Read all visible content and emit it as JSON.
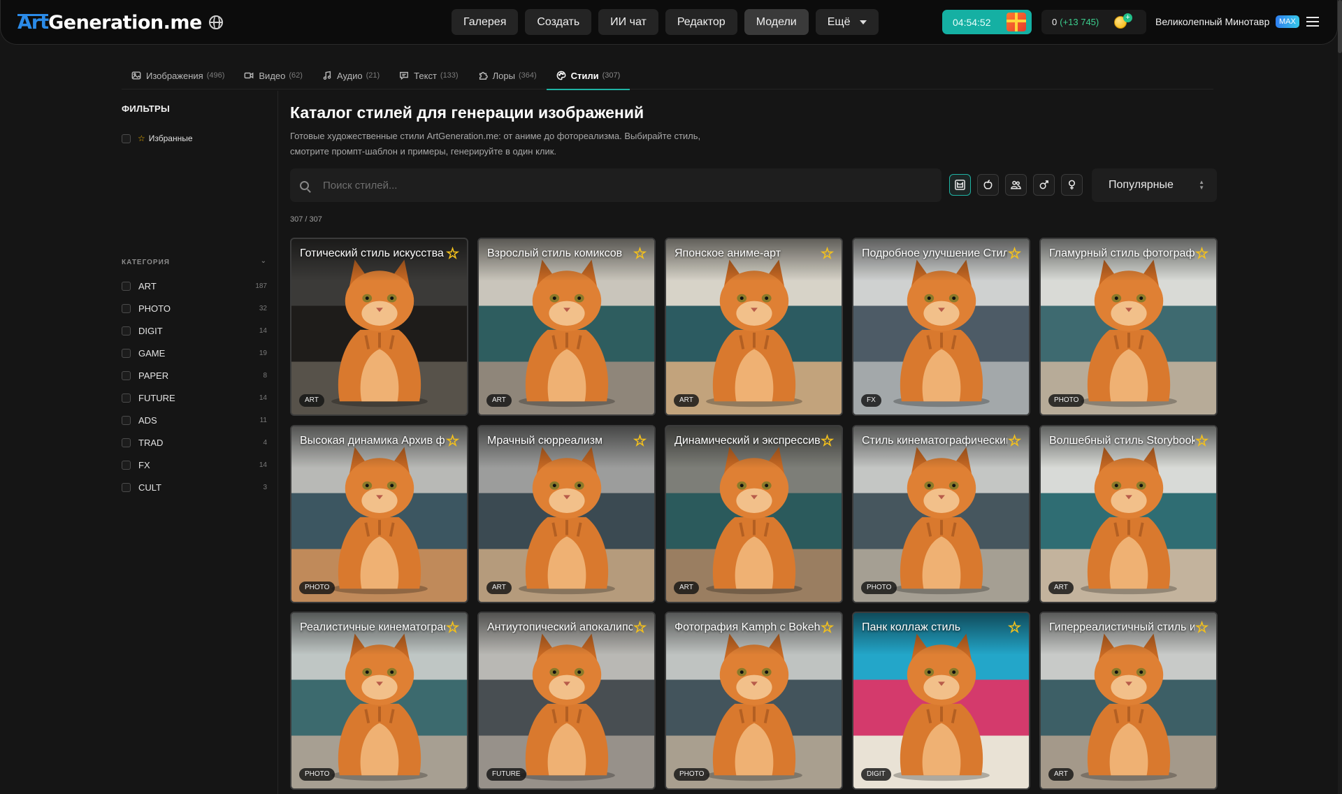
{
  "header": {
    "logo_art": "Art",
    "logo_rest": "Generation.me",
    "nav": [
      {
        "label": "Галерея"
      },
      {
        "label": "Создать"
      },
      {
        "label": "ИИ чат"
      },
      {
        "label": "Редактор"
      },
      {
        "label": "Модели",
        "active": true
      },
      {
        "label": "Ещё"
      }
    ],
    "timer": "04:54:52",
    "coins": "0",
    "coins_plus": "(+13 745)",
    "username": "Великолепный Минотавр",
    "badge": "MAX"
  },
  "subtabs": [
    {
      "label": "Изображения",
      "count": "(496)",
      "icon": "image-icon"
    },
    {
      "label": "Видео",
      "count": "(62)",
      "icon": "video-icon"
    },
    {
      "label": "Аудио",
      "count": "(21)",
      "icon": "music-icon"
    },
    {
      "label": "Текст",
      "count": "(133)",
      "icon": "chat-icon"
    },
    {
      "label": "Лоры",
      "count": "(364)",
      "icon": "puzzle-icon"
    },
    {
      "label": "Стили",
      "count": "(307)",
      "icon": "palette-icon",
      "active": true
    }
  ],
  "sidebar": {
    "title": "ФИЛЬТРЫ",
    "favorites": "Избранные",
    "categories_head": "КАТЕГОРИЯ",
    "categories": [
      {
        "name": "ART",
        "count": "187"
      },
      {
        "name": "PHOTO",
        "count": "32"
      },
      {
        "name": "DIGIT",
        "count": "14"
      },
      {
        "name": "GAME",
        "count": "19"
      },
      {
        "name": "PAPER",
        "count": "8"
      },
      {
        "name": "FUTURE",
        "count": "14"
      },
      {
        "name": "ADS",
        "count": "11"
      },
      {
        "name": "TRAD",
        "count": "4"
      },
      {
        "name": "FX",
        "count": "14"
      },
      {
        "name": "CULT",
        "count": "3"
      }
    ]
  },
  "main": {
    "title": "Каталог стилей для генерации изображений",
    "description": "Готовые художественные стили ArtGeneration.me: от аниме до фотореализма. Выбирайте стиль, смотрите промпт-шаблон и примеры, генерируйте в один клик.",
    "search_placeholder": "Поиск стилей...",
    "sort_label": "Популярные",
    "count": "307 / 307",
    "filter_toggles": [
      {
        "icon": "cat-face-icon",
        "on": true
      },
      {
        "icon": "apple-icon"
      },
      {
        "icon": "group-icon"
      },
      {
        "icon": "male-icon"
      },
      {
        "icon": "female-icon"
      }
    ]
  },
  "cards": [
    {
      "title": "Готический стиль искусства",
      "category": "ART",
      "colors": [
        "#3b3a38",
        "#1e1c1a",
        "#57524a"
      ]
    },
    {
      "title": "Взрослый стиль комиксов",
      "category": "ART",
      "colors": [
        "#c9c5bb",
        "#2e5d5f",
        "#8f867a"
      ]
    },
    {
      "title": "Японское аниме-арт",
      "category": "ART",
      "colors": [
        "#d7d3c8",
        "#2c5b61",
        "#c2a37c"
      ]
    },
    {
      "title": "Подробное улучшение Стиль",
      "category": "FX",
      "colors": [
        "#cfd1d0",
        "#4d5b66",
        "#a3a8aa"
      ]
    },
    {
      "title": "Гламурный стиль фотографии",
      "category": "PHOTO",
      "colors": [
        "#d9dad6",
        "#3e6a70",
        "#b7ab98"
      ]
    },
    {
      "title": "Высокая динамика Архив фото",
      "category": "PHOTO",
      "colors": [
        "#b8b9b6",
        "#3c5661",
        "#c08a5a"
      ]
    },
    {
      "title": "Мрачный сюрреализм",
      "category": "ART",
      "colors": [
        "#9c9d9c",
        "#3b4a52",
        "#b59b7c"
      ]
    },
    {
      "title": "Динамический и экспрессивный",
      "category": "ART",
      "colors": [
        "#7d7e78",
        "#2b5a5c",
        "#9a7e61"
      ]
    },
    {
      "title": "Стиль кинематографический",
      "category": "PHOTO",
      "colors": [
        "#c4c6c4",
        "#46565e",
        "#a59f93"
      ]
    },
    {
      "title": "Волшебный стиль Storybook",
      "category": "ART",
      "colors": [
        "#d8dad7",
        "#2f6d73",
        "#c3b39d"
      ]
    },
    {
      "title": "Реалистичные кинематографичные",
      "category": "PHOTO",
      "colors": [
        "#bfc6c4",
        "#3c6a6e",
        "#a79f92"
      ]
    },
    {
      "title": "Антиутопический апокалипсис",
      "category": "FUTURE",
      "colors": [
        "#b9b8b4",
        "#484e52",
        "#97918a"
      ]
    },
    {
      "title": "Фотография Kamph с Bokeh",
      "category": "PHOTO",
      "colors": [
        "#bfc3c1",
        "#43545c",
        "#a99f8f"
      ]
    },
    {
      "title": "Панк коллаж стиль",
      "category": "DIGIT",
      "colors": [
        "#23a6c9",
        "#d43a6c",
        "#e9e2d5"
      ]
    },
    {
      "title": "Гиперреалистичный стиль и",
      "category": "ART",
      "colors": [
        "#c8cac8",
        "#3d5f66",
        "#a4998a"
      ]
    }
  ]
}
